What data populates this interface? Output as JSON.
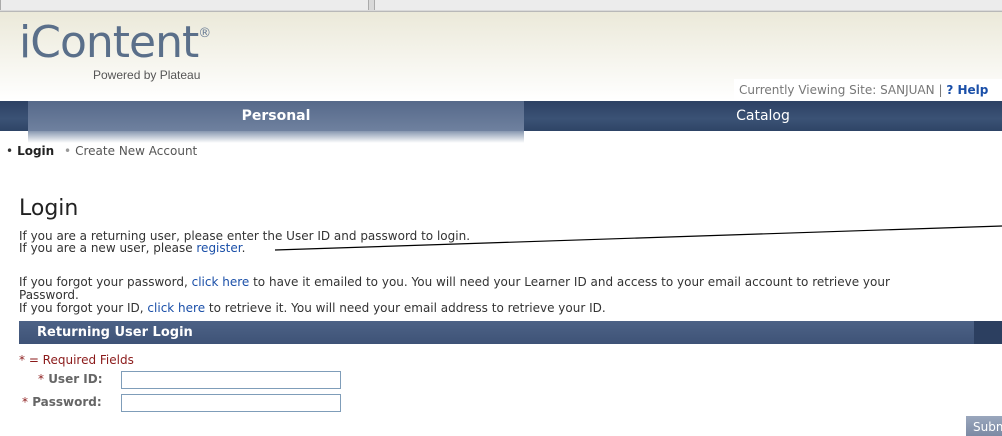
{
  "header": {
    "logo_text": "iContent",
    "logo_mark": "®",
    "logo_sub": "Powered by Plateau",
    "site_label": "Currently Viewing Site: SANJUAN",
    "separator": "|",
    "help_icon": "?",
    "help_label": "Help"
  },
  "nav": {
    "tabs": [
      {
        "label": "Personal",
        "active": true
      },
      {
        "label": "Catalog",
        "active": false
      }
    ]
  },
  "subnav": {
    "bullet": "•",
    "items": [
      {
        "label": "Login",
        "current": true
      },
      {
        "label": "Create New Account",
        "current": false
      }
    ]
  },
  "main": {
    "title": "Login",
    "line1": "If you are a returning user, please enter the User ID and password to login.",
    "line2_prefix": "If you are a new user, please ",
    "line2_link": "register",
    "line2_suffix": ".",
    "line3_prefix": "If you forgot your password, ",
    "line3_link": "click here",
    "line3_suffix": " to have it emailed to you. You will need your Learner ID and access to your email account to retrieve your",
    "line3b": "Password.",
    "line4_prefix": "If you forgot your ID, ",
    "line4_link": "click here",
    "line4_suffix": " to retrieve it. You will need your email address to retrieve your ID."
  },
  "form": {
    "section_title": "Returning User Login",
    "required_note": "* = Required Fields",
    "asterisk": "*",
    "user_label": "User ID:",
    "user_value": "",
    "password_label": "Password:",
    "password_value": "",
    "submit_label": "Submit"
  },
  "colors": {
    "nav_bg": "#2d4163",
    "nav_active": "#6f819f",
    "section_bar": "#4d6286",
    "link": "#1a4fa8",
    "required": "#8b1a1a"
  }
}
